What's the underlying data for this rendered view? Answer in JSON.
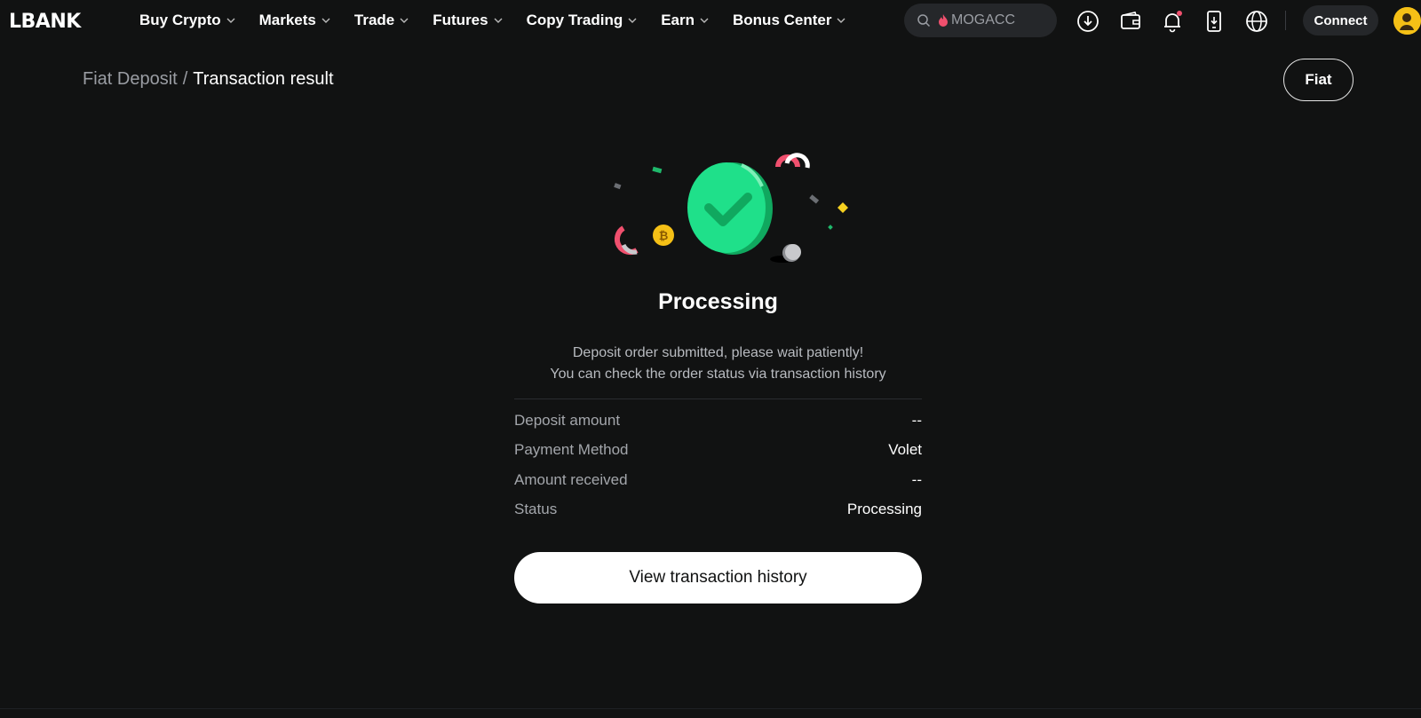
{
  "app": {
    "logo_text": "LBANK"
  },
  "nav": {
    "items": [
      {
        "label": "Buy Crypto"
      },
      {
        "label": "Markets"
      },
      {
        "label": "Trade"
      },
      {
        "label": "Futures"
      },
      {
        "label": "Copy Trading"
      },
      {
        "label": "Earn"
      },
      {
        "label": "Bonus Center"
      }
    ]
  },
  "search": {
    "placeholder": "MOGACC"
  },
  "header": {
    "icons": [
      "download-icon",
      "wallet-icon",
      "bell-icon",
      "app-download-icon",
      "globe-icon"
    ],
    "connect_label": "Connect",
    "notification_dot_color": "#f0506e"
  },
  "breadcrumb": {
    "parent": "Fiat Deposit",
    "separator": "/",
    "current": "Transaction result"
  },
  "fiat_button": {
    "label": "Fiat"
  },
  "result": {
    "title": "Processing",
    "message_line1": "Deposit order submitted, please wait patiently!",
    "message_line2": "You can check the order status via transaction history",
    "rows": [
      {
        "label": "Deposit amount",
        "value": "--"
      },
      {
        "label": "Payment Method",
        "value": "Volet"
      },
      {
        "label": "Amount received",
        "value": "--"
      },
      {
        "label": "Status",
        "value": "Processing"
      }
    ],
    "cta_label": "View transaction history"
  },
  "colors": {
    "background": "#111212",
    "accent_green": "#1fe08a",
    "button_bg": "#ffffff"
  }
}
